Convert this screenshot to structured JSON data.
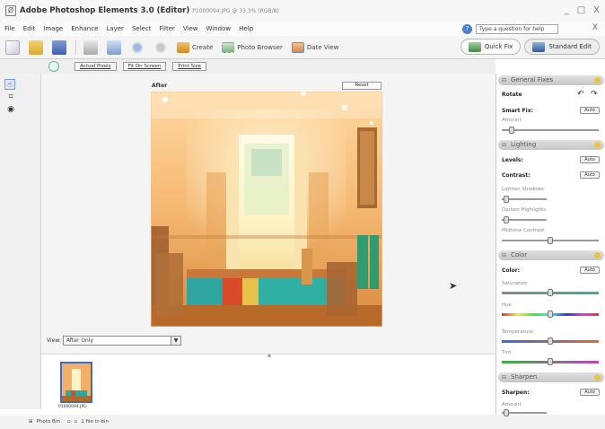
{
  "window": {
    "title": "Adobe Photoshop Elements 3.0 (Editor)",
    "doc_info": "P1000094.JPG @ 33.3% (RGB/8)",
    "min": "_",
    "restore": "□",
    "close": "X"
  },
  "menu": [
    "File",
    "Edit",
    "Image",
    "Enhance",
    "Layer",
    "Select",
    "Filter",
    "View",
    "Window",
    "Help"
  ],
  "help": {
    "placeholder": "Type a question for help",
    "close": "X"
  },
  "shortcuts": {
    "create": "Create",
    "photo_browser": "Photo Browser",
    "date_view": "Date View"
  },
  "modes": {
    "quick_fix": "Quick Fix",
    "standard_edit": "Standard Edit"
  },
  "options": {
    "actual_pixels": "Actual Pixels",
    "fit_on_screen": "Fit On Screen",
    "print_size": "Print Size"
  },
  "canvas": {
    "label": "After",
    "reset": "Reset"
  },
  "view": {
    "label": "View:",
    "selected": "After Only"
  },
  "photobin": {
    "thumb_label": "P1000094.JPG"
  },
  "status": {
    "photo_bin": "Photo Bin",
    "count": "1 file in bin"
  },
  "palette": {
    "general_fixes": {
      "header": "General Fixes",
      "rotate": "Rotate",
      "smart_fix": "Smart Fix:",
      "auto": "Auto",
      "amount": "Amount",
      "amount_value": 0.1
    },
    "lighting": {
      "header": "Lighting",
      "levels": "Levels:",
      "contrast": "Contrast:",
      "auto": "Auto",
      "lighten_shadows": "Lighten Shadows",
      "lighten_value": 0.1,
      "darken_highlights": "Darken Highlights",
      "darken_value": 0.1,
      "midtone_contrast": "Midtone Contrast",
      "midtone_value": 0.5
    },
    "color": {
      "header": "Color",
      "color_label": "Color:",
      "auto": "Auto",
      "saturation": "Saturation",
      "saturation_value": 0.5,
      "hue": "Hue",
      "hue_value": 0.5,
      "temperature": "Temperature",
      "temperature_value": 0.5,
      "tint": "Tint",
      "tint_value": 0.5
    },
    "sharpen": {
      "header": "Sharpen",
      "sharpen_label": "Sharpen:",
      "auto": "Auto",
      "amount": "Amount",
      "amount_value": 0.1
    }
  },
  "colors": {
    "accent": "#4a6ab0",
    "header_grad": "#c6c6c6",
    "help_icon": "#4a7fd0"
  }
}
